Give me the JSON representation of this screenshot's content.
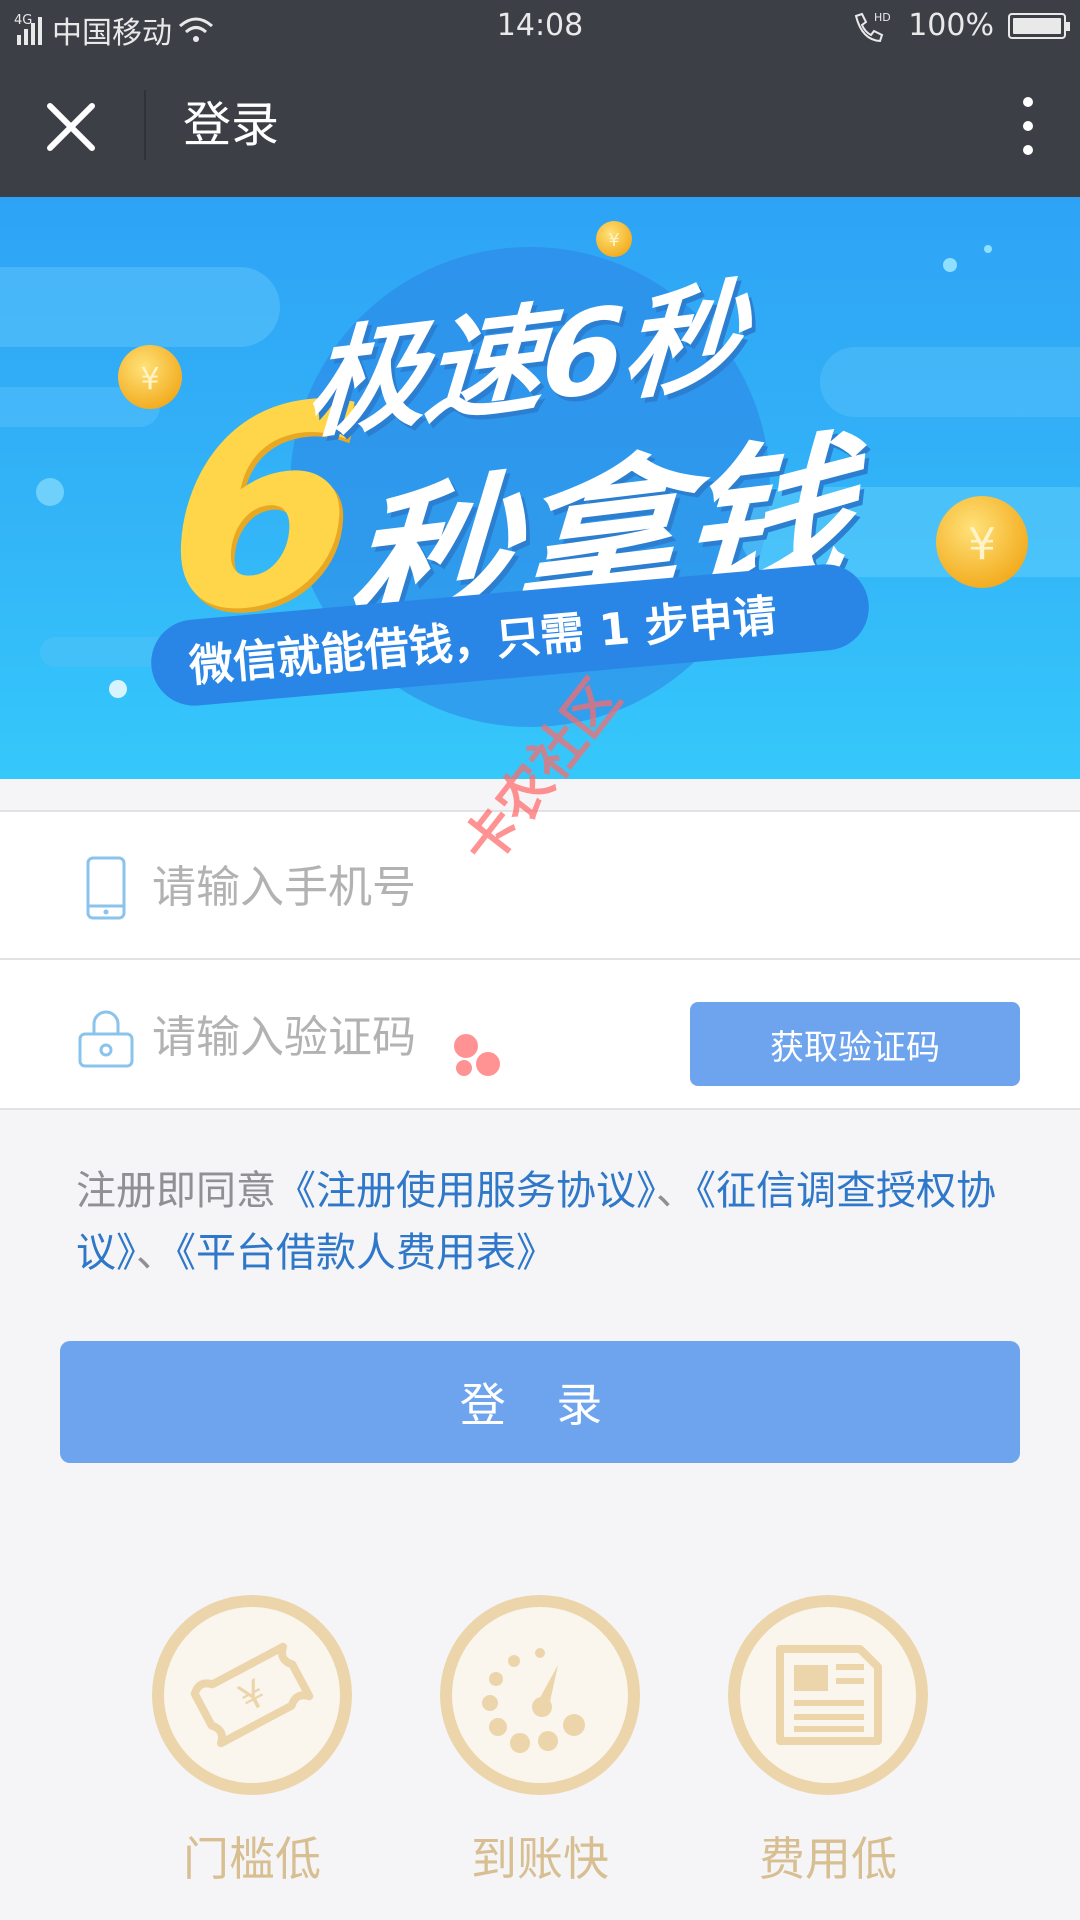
{
  "status_bar": {
    "network": "4G",
    "carrier": "中国移动",
    "time": "14:08",
    "battery": "100%",
    "volte": "HD"
  },
  "nav": {
    "title": "登录"
  },
  "banner": {
    "headline": "极速6秒",
    "big_number": "6",
    "subline": "秒拿钱",
    "slogan": "微信就能借钱，只需 1 步申请"
  },
  "form": {
    "phone_placeholder": "请输入手机号",
    "code_placeholder": "请输入验证码",
    "get_code_label": "获取验证码"
  },
  "agreement": {
    "prefix": "注册即同意",
    "link1": "《注册使用服务协议》",
    "sep1": "、",
    "link2": "《征信调查授权协议》",
    "sep2": "、",
    "link3": "《平台借款人费用表》"
  },
  "login_label": "登 录",
  "features": [
    {
      "label": "门槛低",
      "icon": "money-bill-icon"
    },
    {
      "label": "到账快",
      "icon": "speedometer-icon"
    },
    {
      "label": "费用低",
      "icon": "document-icon"
    }
  ],
  "watermark": "卡农社区",
  "colors": {
    "nav_bg": "#3c3f46",
    "button_blue": "#6ea4ee",
    "link_blue": "#2f78c9",
    "feature_gold": "#ecd5ab"
  }
}
